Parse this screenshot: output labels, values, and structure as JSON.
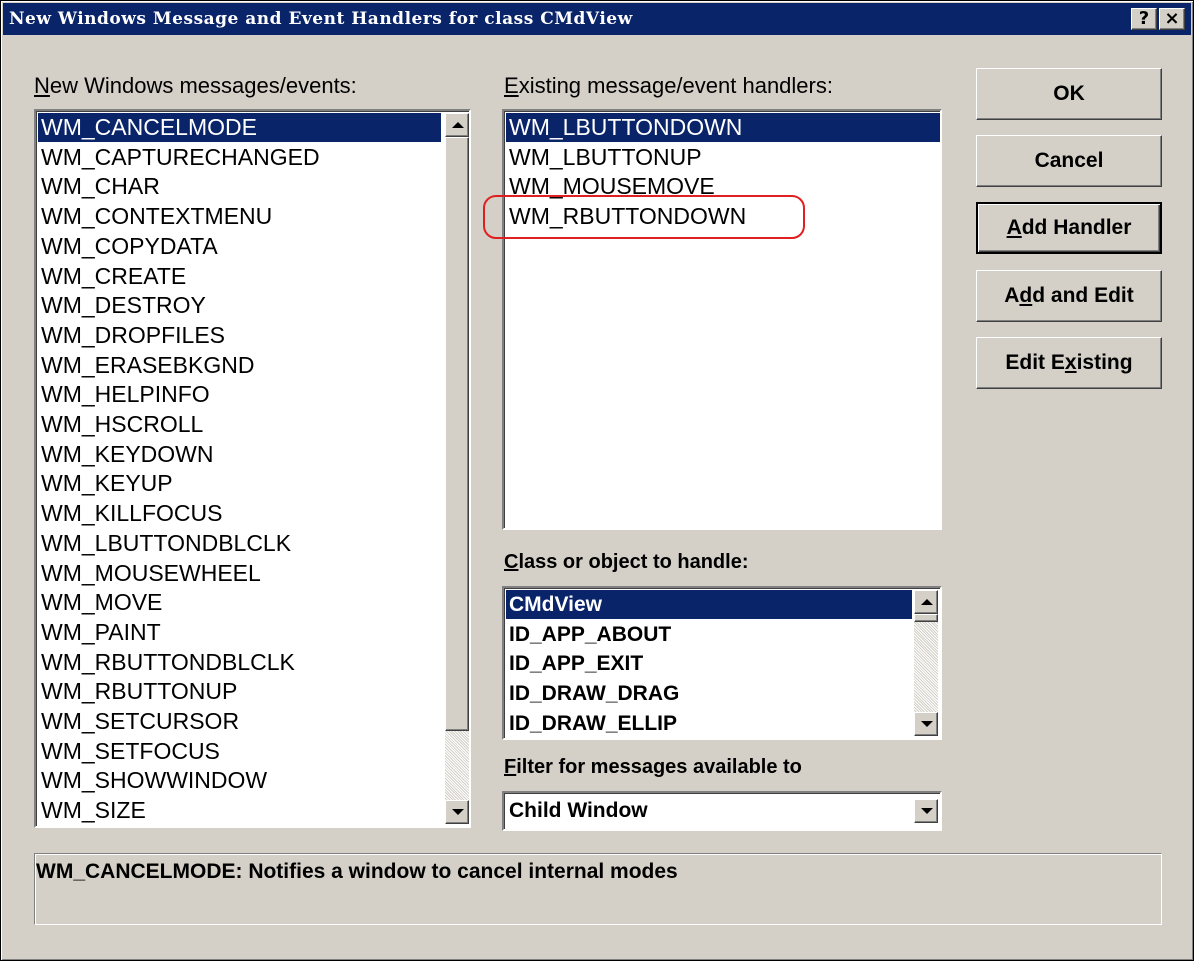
{
  "window": {
    "title": "New Windows Message and Event Handlers for class CMdView",
    "help_label": "?",
    "close_label": "×"
  },
  "new_messages": {
    "label_key": "N",
    "label_rest": "ew Windows messages/events:",
    "items": [
      "WM_CANCELMODE",
      "WM_CAPTURECHANGED",
      "WM_CHAR",
      "WM_CONTEXTMENU",
      "WM_COPYDATA",
      "WM_CREATE",
      "WM_DESTROY",
      "WM_DROPFILES",
      "WM_ERASEBKGND",
      "WM_HELPINFO",
      "WM_HSCROLL",
      "WM_KEYDOWN",
      "WM_KEYUP",
      "WM_KILLFOCUS",
      "WM_LBUTTONDBLCLK",
      "WM_MOUSEWHEEL",
      "WM_MOVE",
      "WM_PAINT",
      "WM_RBUTTONDBLCLK",
      "WM_RBUTTONUP",
      "WM_SETCURSOR",
      "WM_SETFOCUS",
      "WM_SHOWWINDOW",
      "WM_SIZE"
    ],
    "selected": "WM_CANCELMODE"
  },
  "existing_handlers": {
    "label_key": "E",
    "label_rest": "xisting message/event handlers:",
    "items": [
      "WM_LBUTTONDOWN",
      "WM_LBUTTONUP",
      "WM_MOUSEMOVE",
      "WM_RBUTTONDOWN"
    ],
    "selected": "WM_LBUTTONDOWN",
    "highlighted": "WM_RBUTTONDOWN",
    "highlight_color": "#e02020"
  },
  "class_object": {
    "label_key": "C",
    "label_rest": "lass or object to handle:",
    "items": [
      "CMdView",
      "ID_APP_ABOUT",
      "ID_APP_EXIT",
      "ID_DRAW_DRAG",
      "ID_DRAW_ELLIP"
    ],
    "selected": "CMdView"
  },
  "filter": {
    "label_key": "F",
    "label_rest": "ilter for messages available to",
    "value": "Child Window"
  },
  "buttons": {
    "ok": "OK",
    "cancel": "Cancel",
    "add_handler_key": "A",
    "add_handler_rest": "dd Handler",
    "add_edit_pre": "A",
    "add_edit_key": "d",
    "add_edit_rest": "d and Edit",
    "edit_existing_pre": "Edit E",
    "edit_existing_key": "x",
    "edit_existing_rest": "isting"
  },
  "description": "WM_CANCELMODE:  Notifies a window to cancel internal modes",
  "colors": {
    "titlebar": "#0a246a",
    "selection": "#0a246a",
    "face": "#d4d0c8"
  }
}
